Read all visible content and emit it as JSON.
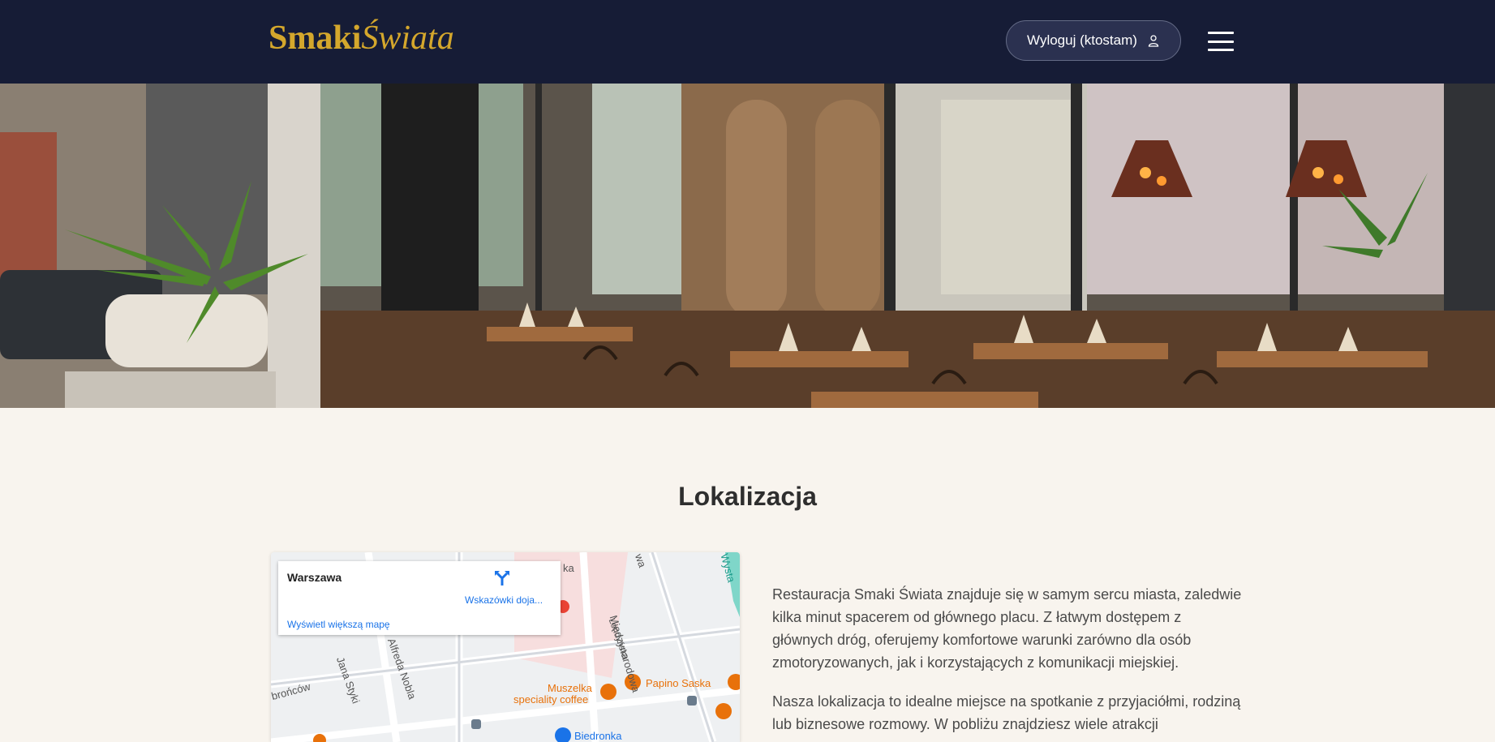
{
  "header": {
    "logo_part1": "Smaki",
    "logo_part2": "Świata",
    "logout_label": "Wyloguj (ktostam)",
    "user_icon": "user-icon",
    "menu_icon": "hamburger-icon"
  },
  "hero": {
    "image": "restaurant-interior-photo"
  },
  "location": {
    "title": "Lokalizacja",
    "map": {
      "city": "Warszawa",
      "directions_label": "Wskazówki doja...",
      "bigger_map_label": "Wyświetl większą mapę",
      "directions_icon": "directions-icon",
      "streets": [
        "Międzynarodowa",
        "Londyńska",
        "Alfreda Nobla",
        "Jana Styki",
        "brońców",
        "Wysta",
        "ka",
        "wa"
      ],
      "pois": [
        "Muszelka",
        "speciality coffee",
        "Papino Saska",
        "Biedronka"
      ]
    },
    "paragraph1": "Restauracja Smaki Świata znajduje się w samym sercu miasta, zaledwie kilka minut spacerem od głównego placu. Z łatwym dostępem z głównych dróg, oferujemy komfortowe warunki zarówno dla osób zmotoryzowanych, jak i korzystających z komunikacji miejskiej.",
    "paragraph2": "Nasza lokalizacja to idealne miejsce na spotkanie z przyjaciółmi, rodziną lub biznesowe rozmowy. W pobliżu znajdziesz wiele atrakcji"
  },
  "colors": {
    "header_bg": "#161c36",
    "logo_gold": "#d4a72c",
    "page_bg": "#f8f4ee",
    "link_blue": "#1a73e8",
    "poi_orange": "#e8710a"
  }
}
